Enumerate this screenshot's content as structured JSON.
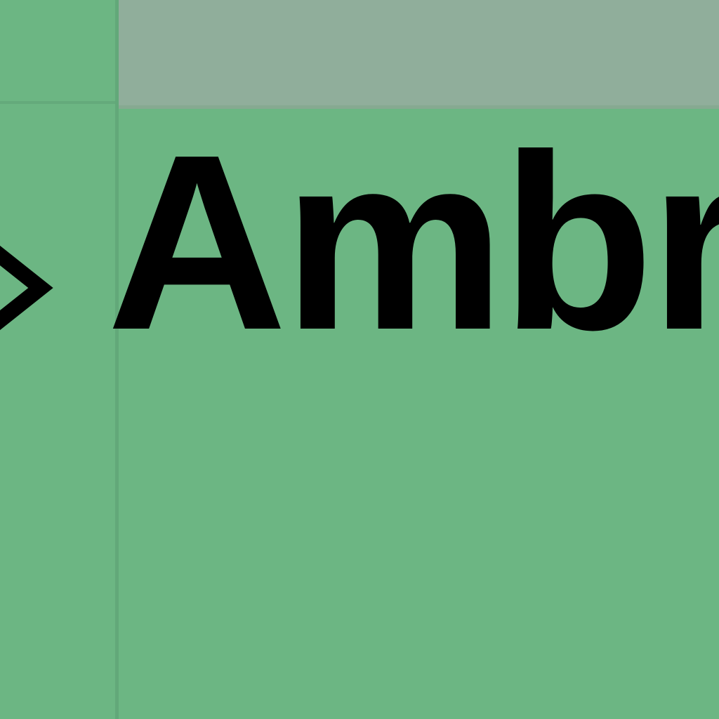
{
  "row": {
    "label": "Ambr",
    "expand_icon": "chevron-right-icon"
  },
  "colors": {
    "row_background": "#6cb683",
    "header_background": "#90ae9b",
    "text": "#000000"
  }
}
